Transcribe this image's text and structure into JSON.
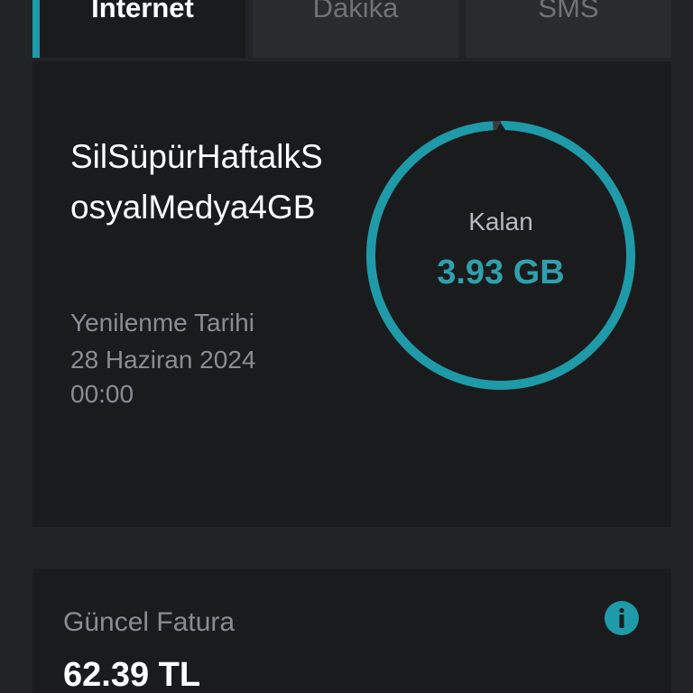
{
  "tabs": [
    {
      "label": "Internet",
      "active": true
    },
    {
      "label": "Dakika",
      "active": false
    },
    {
      "label": "SMS",
      "active": false
    }
  ],
  "package": {
    "name": "SilSüpürHaftalkSosyalMedya4GB",
    "renewal_label": "Yenilenme Tarihi",
    "renewal_date": "28 Haziran 2024 00:00",
    "remaining_label": "Kalan",
    "remaining_value": "3.93 GB",
    "remaining_fraction": 0.99
  },
  "bill": {
    "label": "Güncel Fatura",
    "amount": "62.39 TL"
  },
  "icons": {
    "info": "info-circle-icon"
  },
  "colors": {
    "background": "#222325",
    "card": "#1a1b1d",
    "accent": "#1e9aa8",
    "ring_value": "#2fa0ab",
    "muted_text": "#8a8d91"
  }
}
